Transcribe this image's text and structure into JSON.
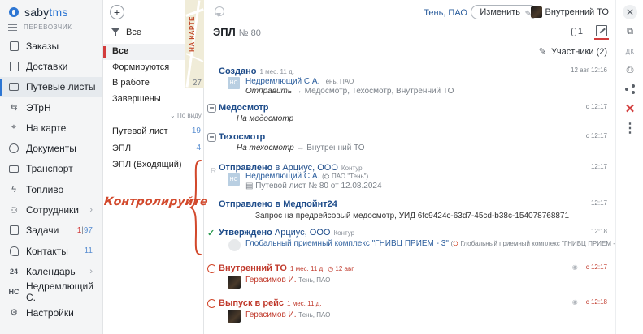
{
  "app": {
    "logo_text": "saby",
    "logo_accent": "tms",
    "role": "ПЕРЕВОЗЧИК"
  },
  "sidebar": {
    "items": [
      {
        "label": "Заказы",
        "icon": "orders-icon"
      },
      {
        "label": "Доставки",
        "icon": "delivery-icon"
      },
      {
        "label": "Путевые листы",
        "icon": "waybill-icon",
        "active": true
      },
      {
        "label": "ЭТрН",
        "icon": "etrn-icon"
      },
      {
        "label": "На карте",
        "icon": "map-pin-icon"
      },
      {
        "label": "Документы",
        "icon": "documents-icon"
      },
      {
        "label": "Транспорт",
        "icon": "truck-icon"
      },
      {
        "label": "Топливо",
        "icon": "fuel-icon"
      },
      {
        "label": "Сотрудники",
        "icon": "employees-icon"
      },
      {
        "label": "Задачи",
        "icon": "tasks-icon",
        "count_red": "1",
        "count_sep": "|",
        "count": "97"
      },
      {
        "label": "Контакты",
        "icon": "contacts-icon",
        "count": "11"
      },
      {
        "label": "Календарь",
        "icon": "calendar-icon",
        "icon_text": "24"
      },
      {
        "label": "Недремлющий С.",
        "icon": "user-initials",
        "icon_text": "НС"
      },
      {
        "label": "Настройки",
        "icon": "settings-icon"
      }
    ]
  },
  "filters": {
    "plus": "+",
    "map_label": "НА КАРТЕ",
    "filter_label": "Все",
    "states": [
      {
        "label": "Все",
        "active": true,
        "count": ""
      },
      {
        "label": "Формируются",
        "count": ""
      },
      {
        "label": "В работе",
        "count": "27"
      },
      {
        "label": "Завершены",
        "count": ""
      }
    ],
    "group_head": "По виду",
    "types": [
      {
        "label": "Путевой лист",
        "count": "19"
      },
      {
        "label": "ЭПЛ",
        "count": "4"
      },
      {
        "label": "ЭПЛ (Входящий)",
        "count": ""
      }
    ]
  },
  "card": {
    "org": "Тень, ПАО",
    "change_label": "Изменить",
    "responsible": "Внутренний ТО",
    "title": "ЭПЛ",
    "number": "№ 80",
    "attachments": "1",
    "participants": "Участники (2)",
    "control_label": "Контролируйте",
    "events": [
      {
        "title": "Создано",
        "meta": "1 мес. 11 д.",
        "time": "12 авг 12:16",
        "author": "Недремлющий С.А.",
        "author_org": "Тень, ПАО",
        "line": "Отправить",
        "line_rest": "Медосмотр, Техосмотр, Внутренний ТО",
        "avatar": "НС"
      },
      {
        "title": "Медосмотр",
        "time": "с 12:17",
        "line": "На медосмотр"
      },
      {
        "title": "Техосмотр",
        "time": "с 12:17",
        "line": "На техосмотр",
        "line_rest": "Внутренний ТО"
      },
      {
        "title": "Отправлено",
        "title_to": "в Арциус, ООО",
        "meta": "Контур",
        "time": "12:17",
        "author": "Недремлющий С.А.",
        "author_org": "ПАО \"Тень\"",
        "line": "Путевой лист № 80 от 12.08.2024",
        "avatar": "НС"
      },
      {
        "title": "Отправлено в Медпойнт24",
        "time": "12:17",
        "line": "Запрос на предрейсовый медосмотр, УИД 6fc9424c-63d7-45cd-b38c-154078768871"
      },
      {
        "title": "Утверждено",
        "title_to": "Арциус, ООО",
        "meta": "Контур",
        "time": "12:18",
        "author": "Глобальный приемный комплекс \"ГНИВЦ ПРИЕМ - 3\"",
        "author_org": "Глобальный приемный комплекс \"ГНИВЦ ПРИЕМ - 3\""
      },
      {
        "title": "Внутренний ТО",
        "meta": "1 мес. 11 д.",
        "deadline": "12 авг",
        "time": "с 12:17",
        "author": "Герасимов И.",
        "author_org": "Тень, ПАО"
      },
      {
        "title": "Выпуск в рейс",
        "meta": "1 мес. 11 д.",
        "time": "с 12:18",
        "author": "Герасимов И.",
        "author_org": "Тень, ПАО"
      }
    ]
  },
  "toolbar": {
    "dk_label": "ДК"
  },
  "colors": {
    "accent": "#2d76d3",
    "link": "#1e4c8a",
    "danger": "#c0392b",
    "success": "#2e9b52"
  }
}
